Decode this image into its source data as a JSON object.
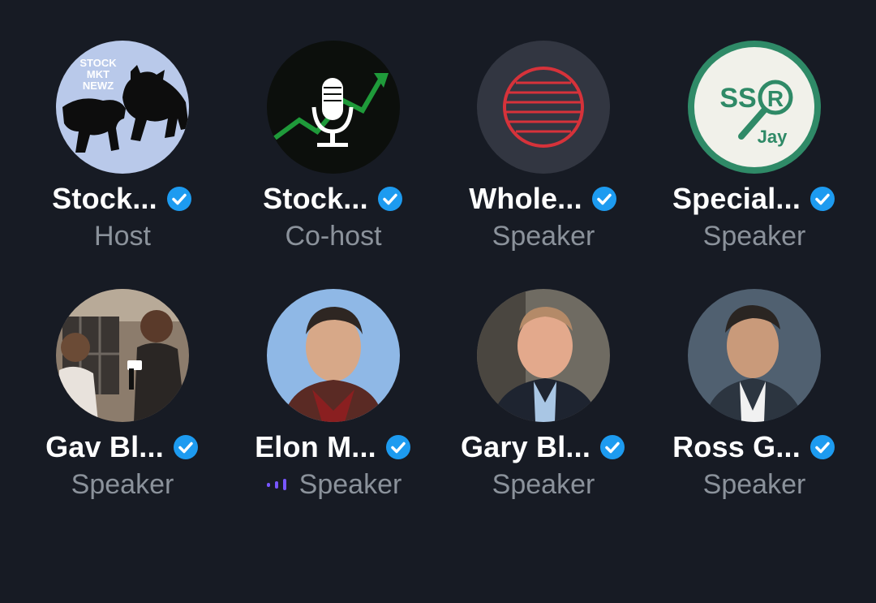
{
  "participants": [
    {
      "name": "Stock...",
      "role": "Host",
      "avatar": "stock-mkt-newz-logo",
      "logo_text": [
        "STOCK",
        "MKT",
        "NEWZ"
      ],
      "verified": true,
      "speaking": false
    },
    {
      "name": "Stock...",
      "role": "Co-host",
      "avatar": "microphone-chart-logo",
      "verified": true,
      "speaking": false
    },
    {
      "name": "Whole...",
      "role": "Speaker",
      "avatar": "red-globe-logo",
      "verified": true,
      "speaking": false
    },
    {
      "name": "Special...",
      "role": "Speaker",
      "avatar": "ssr-jay-logo",
      "logo_text": [
        "SS",
        "R",
        "Jay"
      ],
      "verified": true,
      "speaking": false
    },
    {
      "name": "Gav Bl...",
      "role": "Speaker",
      "avatar": "interview-photo",
      "verified": true,
      "speaking": false
    },
    {
      "name": "Elon M...",
      "role": "Speaker",
      "avatar": "portrait-photo",
      "verified": true,
      "speaking": true
    },
    {
      "name": "Gary Bl...",
      "role": "Speaker",
      "avatar": "portrait-photo",
      "verified": true,
      "speaking": false
    },
    {
      "name": "Ross G...",
      "role": "Speaker",
      "avatar": "portrait-photo",
      "verified": true,
      "speaking": false
    }
  ],
  "colors": {
    "background": "#171b24",
    "name_text": "#ffffff",
    "role_text": "#8b929b",
    "verified_badge": "#1d9bf0",
    "speaking_indicator": "#7856ff"
  }
}
